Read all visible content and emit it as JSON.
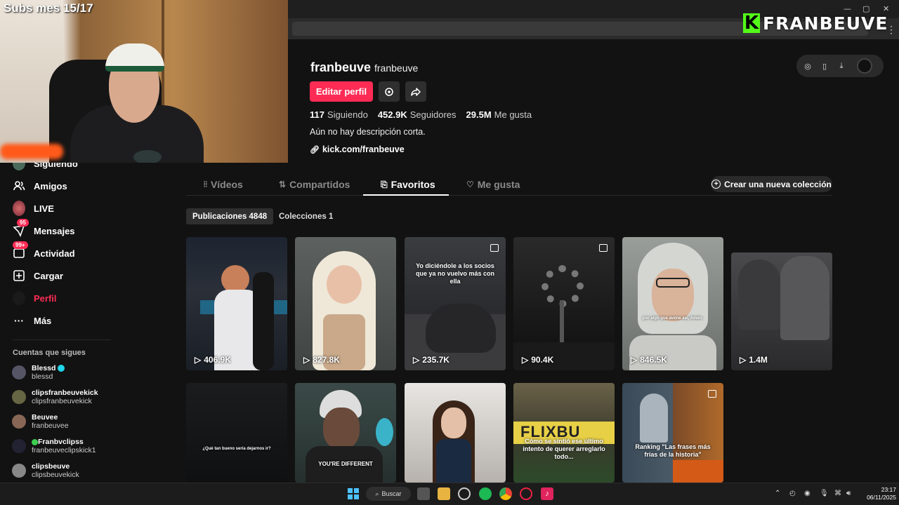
{
  "overlay": {
    "subs_text": "Subs mes 15/17",
    "brand_letter": "K",
    "brand_name": "FRANBEUVE"
  },
  "sidebar": {
    "items": [
      {
        "label": "Siguiendo",
        "icon": "following-avatar-icon"
      },
      {
        "label": "Amigos",
        "icon": "friends-icon"
      },
      {
        "label": "LIVE",
        "icon": "live-icon"
      },
      {
        "label": "Mensajes",
        "icon": "messages-icon",
        "badge": "95"
      },
      {
        "label": "Actividad",
        "icon": "activity-icon",
        "badge": "99+"
      },
      {
        "label": "Cargar",
        "icon": "upload-icon"
      },
      {
        "label": "Perfil",
        "icon": "profile-icon",
        "active": true
      },
      {
        "label": "Más",
        "icon": "more-icon"
      }
    ],
    "following_title": "Cuentas que sigues",
    "following": [
      {
        "name": "Blessd",
        "handle": "blessd",
        "verified": true
      },
      {
        "name": "clipsfranbeuvekick",
        "handle": "clipsfranbeuvekick"
      },
      {
        "name": "Beuvee",
        "handle": "franbeuvee"
      },
      {
        "name": "Franbvclipss",
        "handle": "franbeuveclipskick1",
        "emoji_prefix": true
      },
      {
        "name": "clipsbeuve",
        "handle": "clipsbeuvekick"
      }
    ]
  },
  "profile": {
    "display_name": "franbeuve",
    "username": "franbeuve",
    "edit_label": "Editar perfil",
    "following_count": "117",
    "following_label": "Siguiendo",
    "followers_count": "452.9K",
    "followers_label": "Seguidores",
    "likes_count": "29.5M",
    "likes_label": "Me gusta",
    "bio": "Aún no hay descripción corta.",
    "link": "kick.com/franbeuve"
  },
  "tabs": [
    {
      "label": "Vídeos",
      "icon": "grid-icon"
    },
    {
      "label": "Compartidos",
      "icon": "repost-icon"
    },
    {
      "label": "Favoritos",
      "icon": "bookmark-icon",
      "active": true
    },
    {
      "label": "Me gusta",
      "icon": "heart-icon"
    }
  ],
  "new_collection_label": "Crear una nueva colección",
  "subtabs": [
    {
      "label": "Publicaciones 4848",
      "active": true
    },
    {
      "label": "Colecciones 1"
    }
  ],
  "videos": [
    {
      "views": "406.9K"
    },
    {
      "views": "827.8K"
    },
    {
      "views": "235.7K",
      "caption": "Yo diciéndole a los socios que ya no vuelvo más con ella",
      "photo": true
    },
    {
      "views": "90.4K",
      "photo": true
    },
    {
      "views": "846.5K",
      "caption": "por algo que avene así, Amén."
    },
    {
      "views": "1.4M"
    },
    {
      "views": "",
      "caption": "¿Qué tan bueno sería dejarnos ir?"
    },
    {
      "views": "",
      "caption": "YOU'RE DIFFERENT"
    },
    {
      "views": "",
      "caption": ""
    },
    {
      "views": "",
      "caption": "Cómo se sintió ese último intento de querer arreglarlo todo..."
    },
    {
      "views": "",
      "caption": "Ranking \"Las frases más frías de la historia\"",
      "photo": true
    }
  ],
  "taskbar": {
    "search_label": "Buscar",
    "time": "23:17",
    "date": "06/11/2025"
  }
}
